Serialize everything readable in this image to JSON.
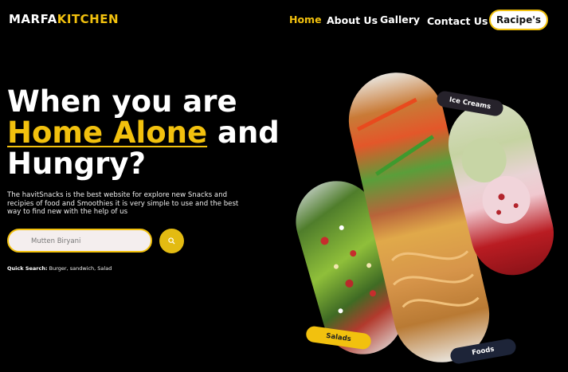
{
  "brand": {
    "part1": "MARFA",
    "part2": "KITCHEN"
  },
  "nav": {
    "home": "Home",
    "about": "About Us",
    "gallery": "Gallery",
    "contact": "Contact Us",
    "recipes": "Racipe's"
  },
  "hero": {
    "line1": "When you are",
    "highlight": "Home Alone",
    "and": " and",
    "line3": "Hungry?"
  },
  "description": "The havitSnacks is the best website for explore new Snacks and recipies of food and Smoothies it is very simple to use and the best way to find new with the help of us",
  "search": {
    "value": "Mutten Biryani",
    "icon": "search-icon"
  },
  "quick_search": {
    "label": "Quick Search:",
    "items": "Burger, sandwich, Salad"
  },
  "categories": {
    "ice_creams": "Ice Creams",
    "salads": "Salads",
    "foods": "Foods"
  },
  "colors": {
    "accent": "#f2c10e",
    "background": "#000000",
    "dark_tag": "#1d2438"
  }
}
